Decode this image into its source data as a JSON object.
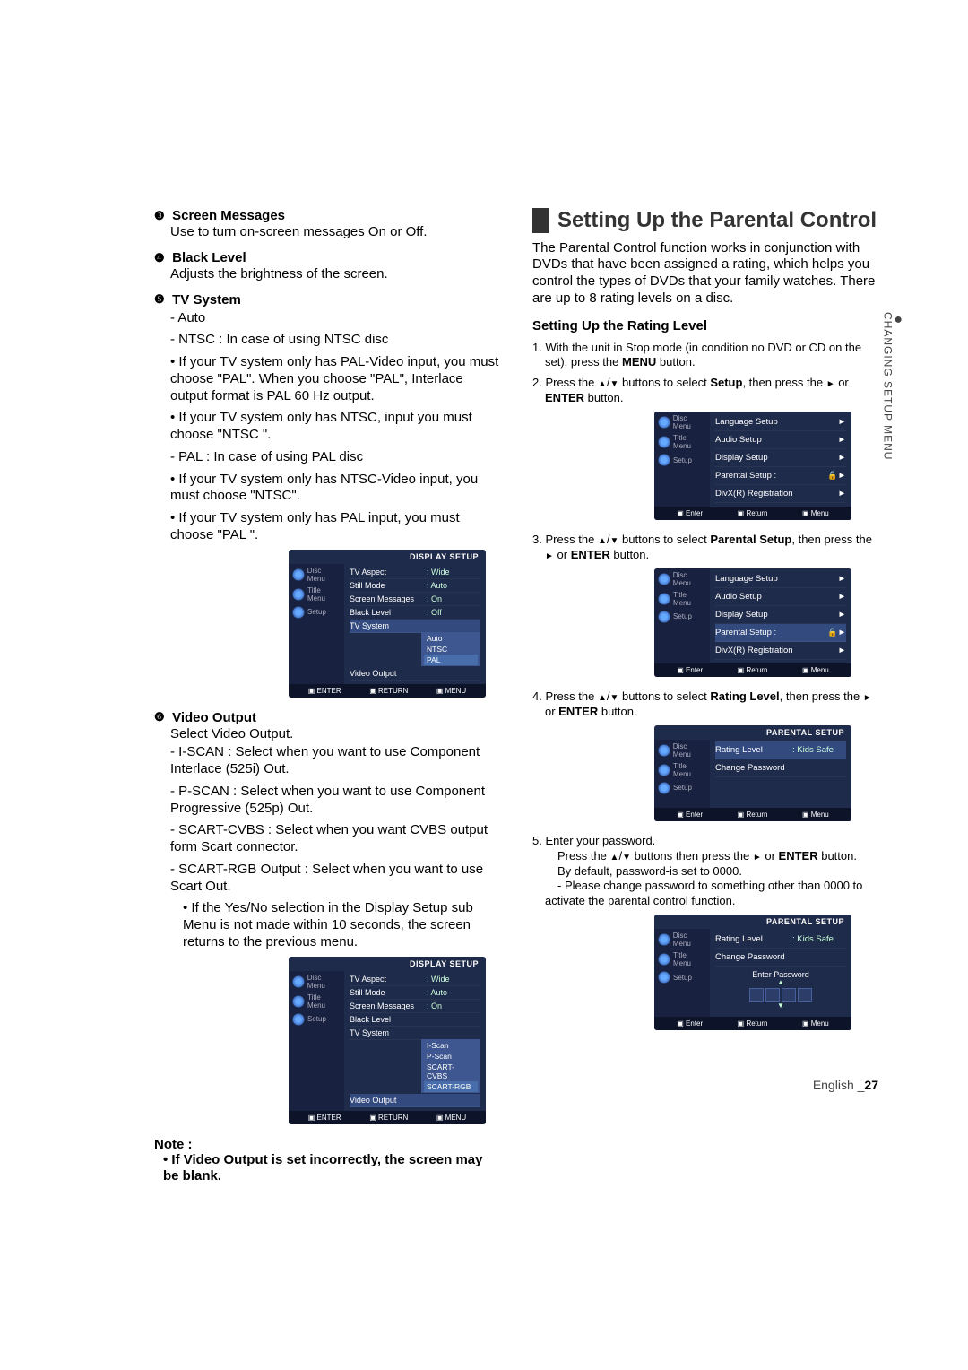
{
  "left": {
    "items": [
      {
        "num": "❸",
        "title": "Screen Messages",
        "desc": "Use to turn on-screen messages On or Off."
      },
      {
        "num": "❹",
        "title": "Black Level",
        "desc": "Adjusts the brightness of the screen."
      },
      {
        "num": "❺",
        "title": "TV System",
        "bullets": [
          "- Auto",
          "- NTSC : In case of using NTSC disc",
          "• If your TV system only has PAL-Video input, you must choose \"PAL\". When you choose \"PAL\", Interlace output format is PAL 60 Hz output.",
          "• If your TV system only has NTSC, input you must choose \"NTSC \".",
          "- PAL : In case of using PAL disc",
          "• If your TV system only has NTSC-Video input, you must choose \"NTSC\".",
          "• If your TV system only has PAL input, you must choose \"PAL \"."
        ]
      },
      {
        "num": "❻",
        "title": "Video Output",
        "desc": "Select Video Output.",
        "bullets": [
          "- I-SCAN : Select when you want to use Component Interlace (525i) Out.",
          "- P-SCAN : Select when you want to use Component Progressive (525p) Out.",
          "- SCART-CVBS : Select when you want CVBS output form Scart connector.",
          "- SCART-RGB Output : Select when you want to use Scart Out."
        ],
        "sub": "• If the Yes/No selection in the Display Setup sub Menu is not made within 10 seconds, the screen returns to the previous menu."
      }
    ],
    "osd1": {
      "title": "DISPLAY SETUP",
      "left": [
        "Disc Menu",
        "Title Menu",
        "Setup"
      ],
      "rows": [
        {
          "lbl": "TV Aspect",
          "val": ": Wide"
        },
        {
          "lbl": "Still Mode",
          "val": ": Auto"
        },
        {
          "lbl": "Screen Messages",
          "val": ": On"
        },
        {
          "lbl": "Black Level",
          "val": ": Off"
        },
        {
          "lbl": "TV System",
          "val": "",
          "hl": true
        },
        {
          "lbl": "Video Output",
          "val": ""
        }
      ],
      "sub": [
        "Auto",
        "NTSC",
        "PAL"
      ],
      "sub_sel": "PAL",
      "footer": [
        "ENTER",
        "RETURN",
        "MENU"
      ]
    },
    "osd2": {
      "title": "DISPLAY SETUP",
      "left": [
        "Disc Menu",
        "Title Menu",
        "Setup"
      ],
      "rows": [
        {
          "lbl": "TV Aspect",
          "val": ": Wide"
        },
        {
          "lbl": "Still Mode",
          "val": ": Auto"
        },
        {
          "lbl": "Screen Messages",
          "val": ": On"
        },
        {
          "lbl": "Black Level",
          "val": ""
        },
        {
          "lbl": "TV System",
          "val": ""
        },
        {
          "lbl": "Video Output",
          "val": "",
          "hl": true
        }
      ],
      "sub": [
        "I-Scan",
        "P-Scan",
        "SCART-CVBS",
        "SCART-RGB"
      ],
      "sub_sel": "SCART-RGB",
      "footer": [
        "ENTER",
        "RETURN",
        "MENU"
      ]
    },
    "note_title": "Note :",
    "note_body": "• If Video Output is set incorrectly, the screen may be blank."
  },
  "right": {
    "heading": "Setting Up the Parental Control",
    "intro": "The Parental Control function works in conjunction with DVDs that have been assigned a rating, which helps you control the types of DVDs that your family watches. There are up to 8 rating levels on a disc.",
    "sub_heading": "Setting Up the Rating Level",
    "step1_a": "1. With the unit in Stop mode (in condition no DVD or CD on the set), press the ",
    "step1_b": "MENU",
    "step1_c": " button.",
    "step2_a": "2. Press the ",
    "step2_b": " buttons to select ",
    "step2_c": "Setup",
    "step2_d": ", then press the ",
    "step2_e": " or ",
    "step2_f": "ENTER",
    "step2_g": " button.",
    "osdA": {
      "left": [
        "Disc Menu",
        "Title Menu",
        "Setup"
      ],
      "rows": [
        {
          "lbl": "Language Setup",
          "arrow": true
        },
        {
          "lbl": "Audio Setup",
          "arrow": true
        },
        {
          "lbl": "Display Setup",
          "arrow": true
        },
        {
          "lbl": "Parental Setup :",
          "lock": true,
          "arrow": true
        },
        {
          "lbl": "DivX(R) Registration",
          "arrow": true
        }
      ],
      "footer": [
        "Enter",
        "Return",
        "Menu"
      ]
    },
    "step3_a": "3. Press the ",
    "step3_b": " buttons to select ",
    "step3_c": "Parental Setup",
    "step3_d": ", then press the ",
    "step3_e": " or ",
    "step3_f": "ENTER",
    "step3_g": " button.",
    "osdB": {
      "left": [
        "Disc Menu",
        "Title Menu",
        "Setup"
      ],
      "rows": [
        {
          "lbl": "Language Setup",
          "arrow": true
        },
        {
          "lbl": "Audio Setup",
          "arrow": true
        },
        {
          "lbl": "Display Setup",
          "arrow": true
        },
        {
          "lbl": "Parental Setup :",
          "lock": true,
          "arrow": true,
          "hl": true
        },
        {
          "lbl": "DivX(R) Registration",
          "arrow": true
        }
      ],
      "footer": [
        "Enter",
        "Return",
        "Menu"
      ]
    },
    "step4_a": "4. Press the ",
    "step4_b": " buttons to select ",
    "step4_c": "Rating Level",
    "step4_d": ", then press the ",
    "step4_e": " or ",
    "step4_f": "ENTER",
    "step4_g": " button.",
    "osdC": {
      "title": "PARENTAL SETUP",
      "left": [
        "Disc Menu",
        "Title Menu",
        "Setup"
      ],
      "rows": [
        {
          "lbl": "Rating Level",
          "val": ": Kids Safe",
          "hl": true
        },
        {
          "lbl": "Change Password",
          "val": ""
        }
      ],
      "footer": [
        "Enter",
        "Return",
        "Menu"
      ]
    },
    "step5_a": "5. Enter your password.",
    "step5_b": "Press the ",
    "step5_c": " buttons then press the ",
    "step5_d": " or ",
    "step5_e": "ENTER",
    "step5_f": " button.",
    "step5_g": "By default, password-is set to 0000.",
    "step5_h": "- Please change password to something other than 0000 to activate the parental control function.",
    "osdD": {
      "title": "PARENTAL SETUP",
      "left": [
        "Disc Menu",
        "Title Menu",
        "Setup"
      ],
      "rows": [
        {
          "lbl": "Rating Level",
          "val": ": Kids Safe"
        },
        {
          "lbl": "Change Password",
          "val": ""
        }
      ],
      "pw_title": "Enter Password",
      "footer": [
        "Enter",
        "Return",
        "Menu"
      ]
    }
  },
  "side_tab": "CHANGING SETUP MENU",
  "footer": {
    "lang": "English",
    "page": "27"
  }
}
